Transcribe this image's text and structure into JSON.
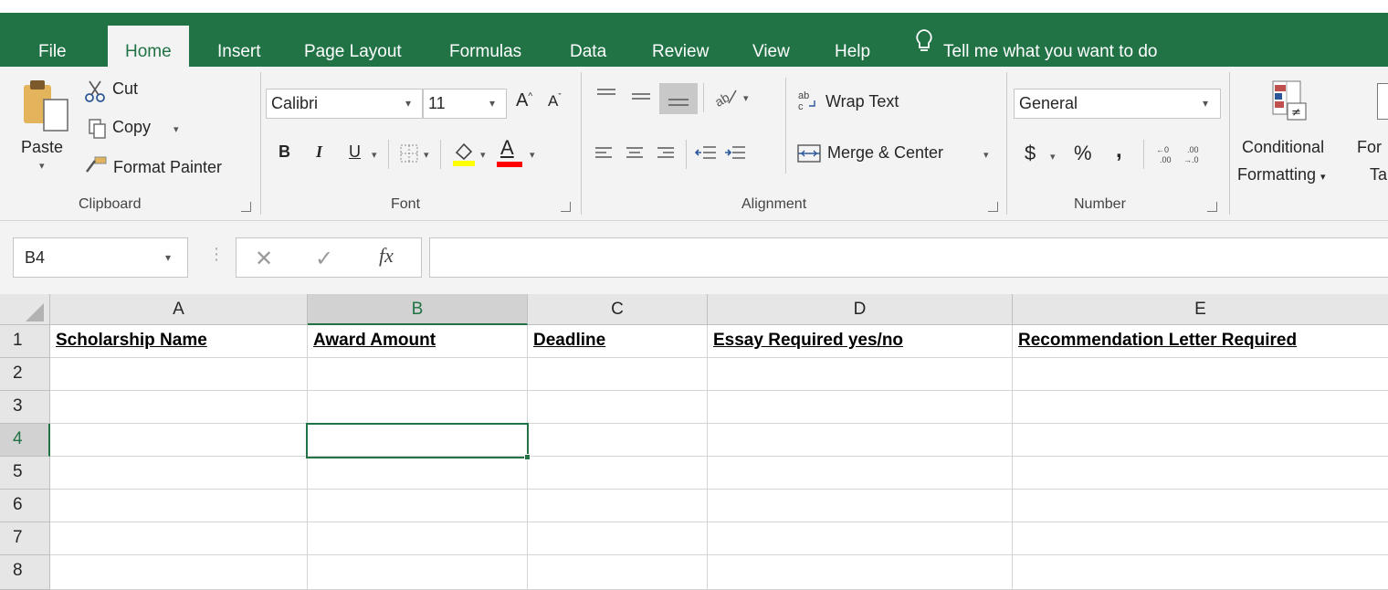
{
  "tabs": [
    "File",
    "Home",
    "Insert",
    "Page Layout",
    "Formulas",
    "Data",
    "Review",
    "View",
    "Help"
  ],
  "tell_me": "Tell me what you want to do",
  "clipboard": {
    "paste": "Paste",
    "cut": "Cut",
    "copy": "Copy",
    "format_painter": "Format Painter",
    "group": "Clipboard"
  },
  "font": {
    "name": "Calibri",
    "size": "11",
    "bold": "B",
    "italic": "I",
    "underline": "U",
    "color_letter": "A",
    "grow": "A",
    "shrink": "A",
    "group": "Font"
  },
  "alignment": {
    "wrap_text": "Wrap Text",
    "merge_center": "Merge & Center",
    "group": "Alignment"
  },
  "number": {
    "format": "General",
    "currency": "$",
    "percent": "%",
    "comma": ",",
    "group": "Number"
  },
  "styles": {
    "conditional_line1": "Conditional",
    "conditional_line2": "Formatting",
    "format_as_line1": "For",
    "format_as_line2": "Ta"
  },
  "formula_bar": {
    "name_box": "B4",
    "fx": "fx",
    "value": ""
  },
  "columns": [
    "A",
    "B",
    "C",
    "D",
    "E"
  ],
  "rows": [
    "1",
    "2",
    "3",
    "4",
    "5",
    "6",
    "7",
    "8"
  ],
  "cells": {
    "A1": "Scholarship Name",
    "B1": "Award Amount",
    "C1": "Deadline",
    "D1": "Essay Required yes/no",
    "E1": "Recommendation Letter Required"
  },
  "selected_cell": "B4",
  "colors": {
    "accent": "#217346",
    "fill_bar": "#ffff00",
    "font_bar": "#ff0000"
  }
}
